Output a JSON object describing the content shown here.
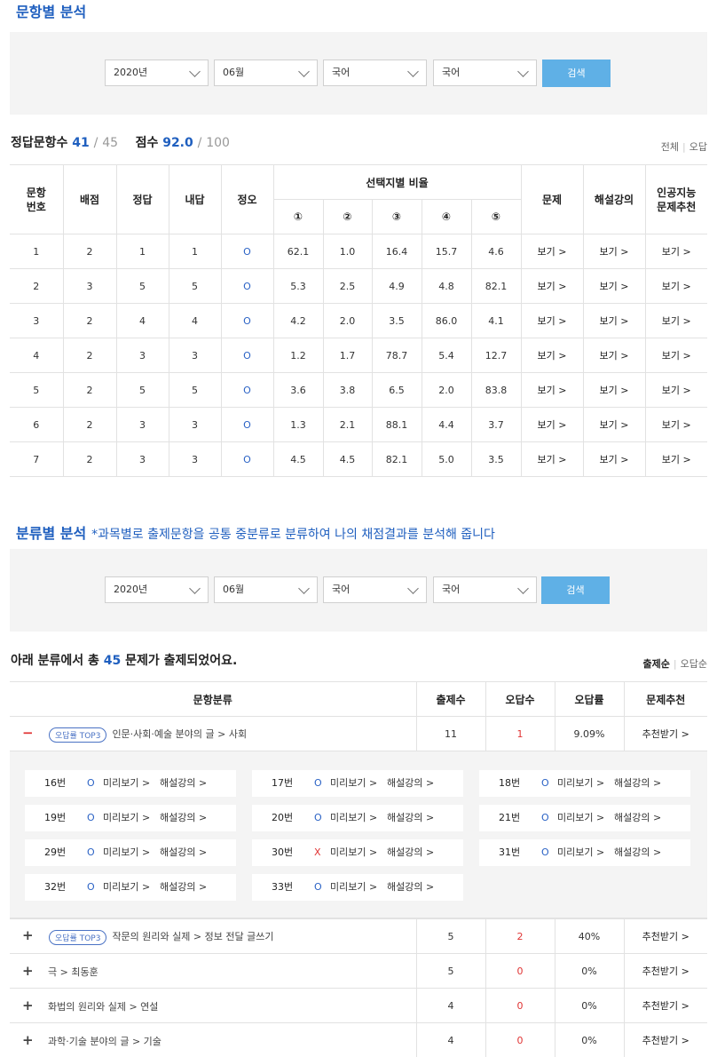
{
  "section1": {
    "title": "문항별 분석",
    "filters": {
      "year": "2020년",
      "month": "06월",
      "subject": "국어",
      "sub_subject": "국어",
      "search": "검색"
    },
    "score": {
      "label_correct": "정답문항수",
      "correct": "41",
      "total_q": "45",
      "label_score": "점수",
      "score": "92.0",
      "max": "100"
    },
    "view_links": {
      "all": "전체",
      "wrong": "오답"
    },
    "table": {
      "headers": {
        "no": "문항\n번호",
        "points": "배점",
        "answer": "정답",
        "mine": "내답",
        "ox": "정오",
        "ratio": "선택지별 비율",
        "problem": "문제",
        "lecture": "해설강의",
        "ai": "인공지능\n문제추천"
      },
      "choices": [
        "①",
        "②",
        "③",
        "④",
        "⑤"
      ],
      "view_label": "보기 >",
      "rows": [
        {
          "no": "1",
          "points": "2",
          "answer": "1",
          "mine": "1",
          "ox": "O",
          "r": [
            "62.1",
            "1.0",
            "16.4",
            "15.7",
            "4.6"
          ]
        },
        {
          "no": "2",
          "points": "3",
          "answer": "5",
          "mine": "5",
          "ox": "O",
          "r": [
            "5.3",
            "2.5",
            "4.9",
            "4.8",
            "82.1"
          ]
        },
        {
          "no": "3",
          "points": "2",
          "answer": "4",
          "mine": "4",
          "ox": "O",
          "r": [
            "4.2",
            "2.0",
            "3.5",
            "86.0",
            "4.1"
          ]
        },
        {
          "no": "4",
          "points": "2",
          "answer": "3",
          "mine": "3",
          "ox": "O",
          "r": [
            "1.2",
            "1.7",
            "78.7",
            "5.4",
            "12.7"
          ]
        },
        {
          "no": "5",
          "points": "2",
          "answer": "5",
          "mine": "5",
          "ox": "O",
          "r": [
            "3.6",
            "3.8",
            "6.5",
            "2.0",
            "83.8"
          ]
        },
        {
          "no": "6",
          "points": "2",
          "answer": "3",
          "mine": "3",
          "ox": "O",
          "r": [
            "1.3",
            "2.1",
            "88.1",
            "4.4",
            "3.7"
          ]
        },
        {
          "no": "7",
          "points": "2",
          "answer": "3",
          "mine": "3",
          "ox": "O",
          "r": [
            "4.5",
            "4.5",
            "82.1",
            "5.0",
            "3.5"
          ]
        }
      ]
    }
  },
  "section2": {
    "title": "분류별 분석",
    "desc": "*과목별로 출제문항을 공통 중분류로 분류하여 나의 채점결과를 분석해 줍니다",
    "filters": {
      "year": "2020년",
      "month": "06월",
      "subject": "국어",
      "sub_subject": "국어",
      "search": "검색"
    },
    "summary": {
      "prefix": "아래 분류에서 총",
      "count": "45",
      "suffix": "문제가 출제되었어요."
    },
    "sort_links": {
      "by_count": "출제순",
      "by_wrong": "오답순"
    },
    "table": {
      "headers": {
        "cls": "문항분류",
        "count": "출제수",
        "wrong": "오답수",
        "rate": "오답률",
        "rec": "문제추천"
      },
      "rec_label": "추천받기 >",
      "badge": "오답률 TOP3",
      "rows": [
        {
          "toggle": "−",
          "badge": true,
          "cls": "인문·사회·예술 분야의 글 > 사회",
          "count": "11",
          "wrong": "1",
          "rate": "9.09%"
        },
        {
          "toggle": "+",
          "badge": true,
          "cls": "작문의 원리와 실제 > 정보 전달 글쓰기",
          "count": "5",
          "wrong": "2",
          "rate": "40%"
        },
        {
          "toggle": "+",
          "badge": false,
          "cls": "극 > 최동훈",
          "count": "5",
          "wrong": "0",
          "rate": "0%"
        },
        {
          "toggle": "+",
          "badge": false,
          "cls": "화법의 원리와 실제 > 연설",
          "count": "4",
          "wrong": "0",
          "rate": "0%"
        },
        {
          "toggle": "+",
          "badge": false,
          "cls": "과학·기술 분야의 글 > 기술",
          "count": "4",
          "wrong": "0",
          "rate": "0%"
        }
      ],
      "detail": {
        "preview_label": "미리보기 >",
        "lecture_label": "해설강의 >",
        "items": [
          {
            "no": "16번",
            "mark": "O"
          },
          {
            "no": "17번",
            "mark": "O"
          },
          {
            "no": "18번",
            "mark": "O"
          },
          {
            "no": "19번",
            "mark": "O"
          },
          {
            "no": "20번",
            "mark": "O"
          },
          {
            "no": "21번",
            "mark": "O"
          },
          {
            "no": "29번",
            "mark": "O"
          },
          {
            "no": "30번",
            "mark": "X"
          },
          {
            "no": "31번",
            "mark": "O"
          },
          {
            "no": "32번",
            "mark": "O"
          },
          {
            "no": "33번",
            "mark": "O"
          }
        ]
      }
    }
  }
}
